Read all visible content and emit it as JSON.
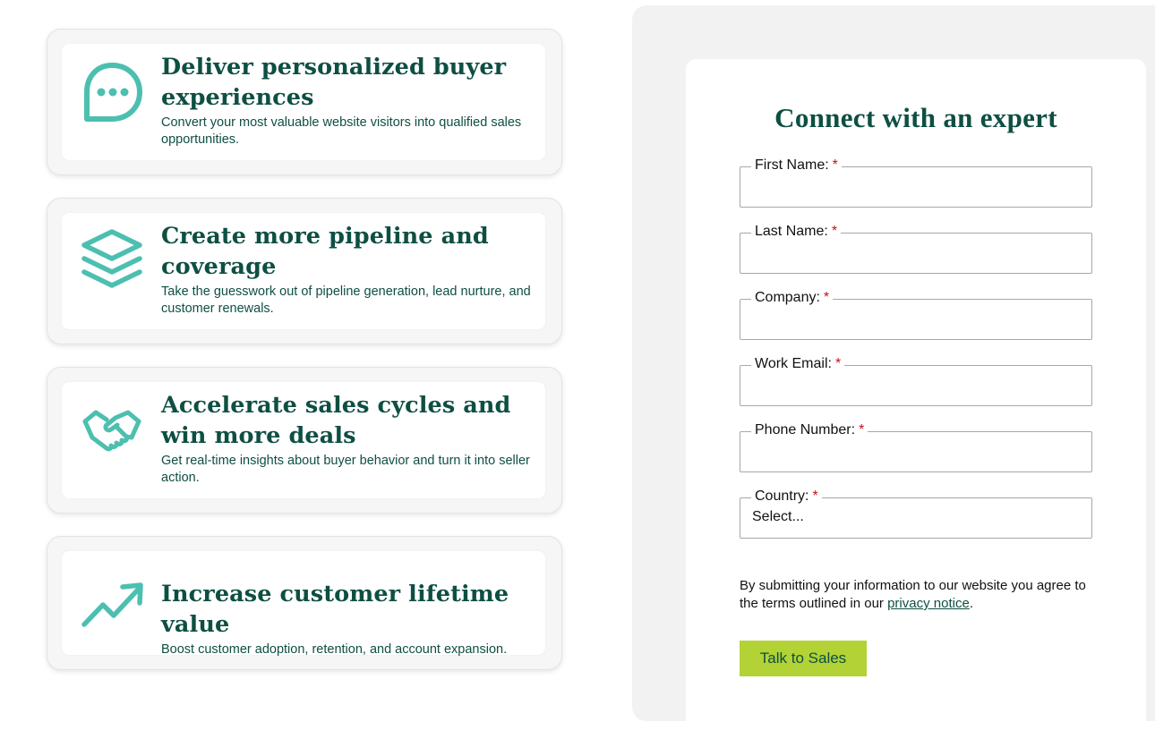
{
  "features": [
    {
      "icon": "chat-bubble-icon",
      "title": "Deliver personalized buyer experiences",
      "description": "Convert your most valuable website visitors into qualified sales opportunities."
    },
    {
      "icon": "stacked-layers-icon",
      "title": "Create more pipeline and coverage",
      "description": "Take the guesswork out of pipeline generation, lead nurture, and customer renewals."
    },
    {
      "icon": "handshake-icon",
      "title": "Accelerate sales cycles and win more deals",
      "description": "Get real-time insights about buyer behavior and turn it into seller action."
    },
    {
      "icon": "trending-up-icon",
      "title": "Increase customer lifetime value",
      "description": "Boost customer adoption, retention, and account expansion."
    }
  ],
  "form": {
    "title": "Connect with an expert",
    "fields": {
      "first_name": {
        "label": "First Name:",
        "required_mark": "*",
        "value": ""
      },
      "last_name": {
        "label": "Last Name:",
        "required_mark": "*",
        "value": ""
      },
      "company": {
        "label": "Company:",
        "required_mark": "*",
        "value": ""
      },
      "work_email": {
        "label": "Work Email:",
        "required_mark": "*",
        "value": ""
      },
      "phone": {
        "label": "Phone Number:",
        "required_mark": "*",
        "value": ""
      },
      "country": {
        "label": "Country:",
        "required_mark": "*",
        "selected": "Select..."
      }
    },
    "consent_text_before": "By submitting your information to our website you agree to the terms outlined in our ",
    "consent_link": "privacy notice",
    "consent_text_after": ".",
    "submit_label": "Talk to Sales"
  },
  "colors": {
    "accent_teal": "#4dbfb0",
    "heading_green": "#0e4f43",
    "button_lime": "#b2d235",
    "required_red": "#c0111f"
  }
}
